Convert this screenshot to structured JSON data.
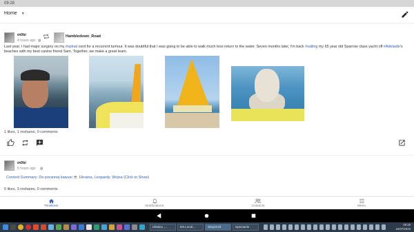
{
  "status_bar": {
    "time": "09:28"
  },
  "app_bar": {
    "selector_label": "Home"
  },
  "posts": [
    {
      "author": "m0bi",
      "time": "4 hours ago",
      "reshared_from": "Hambledown_Road",
      "text": {
        "part1": "Last year, I had major surgery on my ",
        "tag1": "#spinal",
        "part2": " cord for a recurrent tumour. It was doubtful that I was going to be able to walk much less return to the water. Seven months later, I'm back ",
        "tag2": "#sailing",
        "part3": " my 65 year old Sparrow class yacht off ",
        "tag3": "#Adelaide",
        "part4": "'s beaches with my best canine friend Sam. Together, we make a great team."
      },
      "stats": "1 likes, 1 reshares, 0 comments"
    },
    {
      "author": "m0bi",
      "time": "5 hours ago",
      "summary": "Content Summary: Do porannej kawusi ☕ Ukraina, Leopardy, Wojna (Click to Show)",
      "stats": "0 likes, 3 reshares, 0 comments"
    }
  ],
  "bottom_nav": [
    {
      "label": "Timelines",
      "icon": "home-icon",
      "active": true
    },
    {
      "label": "Notifications",
      "icon": "bell-icon",
      "active": false
    },
    {
      "label": "Contacts",
      "icon": "people-icon",
      "active": false
    },
    {
      "label": "Menu",
      "icon": "menu-icon",
      "active": false
    }
  ],
  "taskbar": {
    "windows": [
      "relatica …",
      "D6 Local…",
      "Waydroid",
      "Spectacle"
    ],
    "clock_time": "09:28",
    "clock_date": "22/07/2023"
  },
  "colors": {
    "accent": "#3b5db0",
    "link": "#2f5fb3",
    "taskbar": "#2c3a4a"
  }
}
